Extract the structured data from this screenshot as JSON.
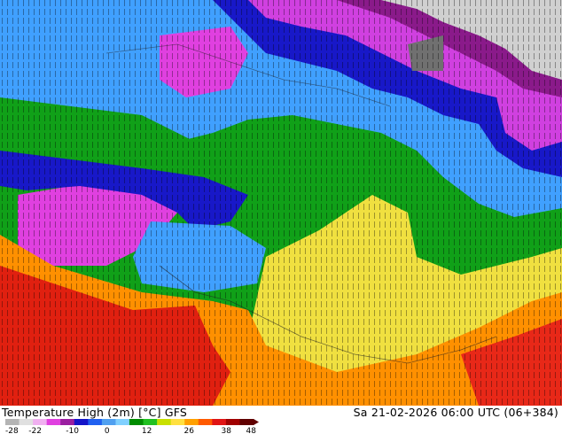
{
  "map": {
    "title": "Temperature High (2m) [°C] GFS",
    "run_info": "Sa 21-02-2026 06:00 UTC (06+384)"
  },
  "legend": {
    "ticks": [
      "-28",
      "-22",
      "-10",
      "0",
      "12",
      "26",
      "38",
      "48"
    ],
    "colors": [
      "#b4b4b4",
      "#e0e0e0",
      "#f0b0f0",
      "#e040e0",
      "#9a1ea0",
      "#1414c8",
      "#2060f0",
      "#50a0f0",
      "#80d0ff",
      "#008c00",
      "#20c020",
      "#c8e000",
      "#ffe040",
      "#ffa000",
      "#ff5a00",
      "#e01414",
      "#a00000",
      "#600000"
    ]
  },
  "palette": {
    "grey_dark": "#707070",
    "grey_light": "#d8d8d8",
    "violet_dark": "#8a1a8a",
    "magenta": "#e040e0",
    "pink": "#f070f0",
    "navy": "#1010c0",
    "blue": "#2050ee",
    "cyan": "#40a0ff",
    "green_dark": "#008a00",
    "green": "#10b020",
    "yellow": "#f0e040",
    "orange": "#ff9000",
    "red": "#e02010"
  }
}
